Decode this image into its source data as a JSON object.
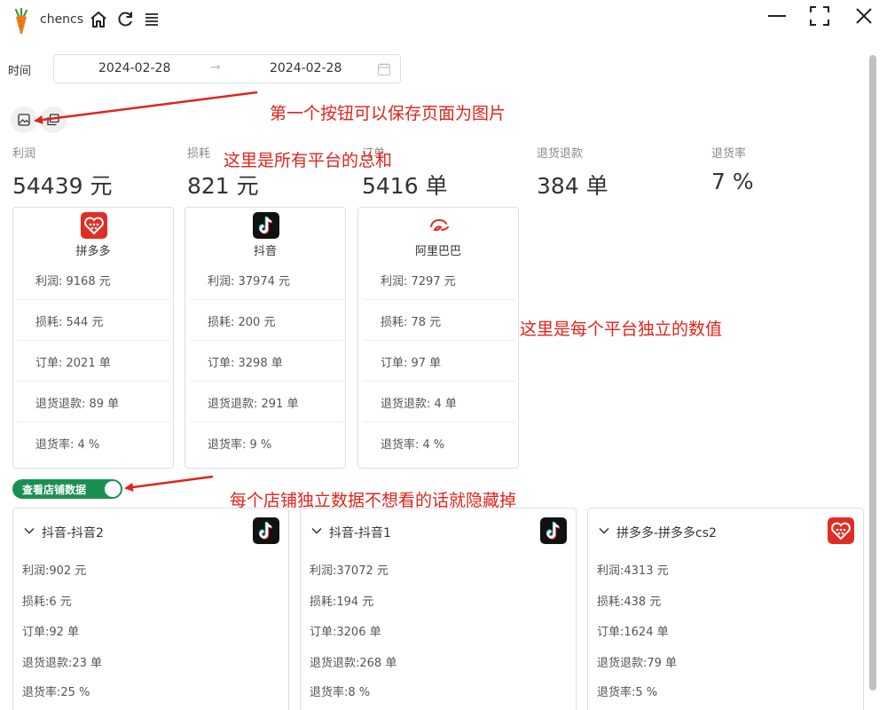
{
  "titlebar": {
    "app_name": "chencs"
  },
  "filter": {
    "time_label": "时间",
    "date_start": "2024-02-28",
    "date_end": "2024-02-28",
    "separator": "→"
  },
  "summary": [
    {
      "label": "利润",
      "value": "54439 元"
    },
    {
      "label": "损耗",
      "value": "821 元"
    },
    {
      "label": "订单",
      "value": "5416 单"
    },
    {
      "label": "退货退款",
      "value": "384 单"
    },
    {
      "label": "退货率",
      "value": "7 %"
    }
  ],
  "platforms": [
    {
      "name": "拼多多",
      "icon": "pinduoduo-logo-icon",
      "color": "#e02e24",
      "rows": [
        "利润:  9168 元",
        "损耗:  544 元",
        "订单:  2021 单",
        "退货退款:  89 单",
        "退货率:  4 %"
      ]
    },
    {
      "name": "抖音",
      "icon": "douyin-logo-icon",
      "color": "#111111",
      "rows": [
        "利润:  37974 元",
        "损耗:  200 元",
        "订单:  3298 单",
        "退货退款:  291 单",
        "退货率:  9 %"
      ]
    },
    {
      "name": "阿里巴巴",
      "icon": "alibaba-logo-icon",
      "color": "#e02e24",
      "rows": [
        "利润:  7297 元",
        "损耗:  78 元",
        "订单:  97 单",
        "退货退款:  4 单",
        "退货率:  4 %"
      ]
    }
  ],
  "toggle": {
    "label": "查看店铺数据",
    "on": true,
    "color": "#1a8f54"
  },
  "shops": [
    {
      "name": "抖音-抖音2",
      "icon": "douyin-logo-icon",
      "rows": [
        "利润:902 元",
        "损耗:6 元",
        "订单:92 单",
        "退货退款:23 单",
        "退货率:25 %"
      ]
    },
    {
      "name": "抖音-抖音1",
      "icon": "douyin-logo-icon",
      "rows": [
        "利润:37072 元",
        "损耗:194 元",
        "订单:3206 单",
        "退货退款:268 单",
        "退货率:8 %"
      ]
    },
    {
      "name": "拼多多-拼多多cs2",
      "icon": "pinduoduo-logo-icon",
      "rows": [
        "利润:4313 元",
        "损耗:438 元",
        "订单:1624 单",
        "退货退款:79 单",
        "退货率:5 %"
      ]
    }
  ],
  "annotations": {
    "save_button": "第一个按钮可以保存页面为图片",
    "summary": "这里是所有平台的总和",
    "platform": "这里是每个平台独立的数值",
    "toggle": "每个店铺独立数据不想看的话就隐藏掉"
  },
  "colors": {
    "accent": "#1a8f54",
    "annotation": "#e2231a"
  }
}
